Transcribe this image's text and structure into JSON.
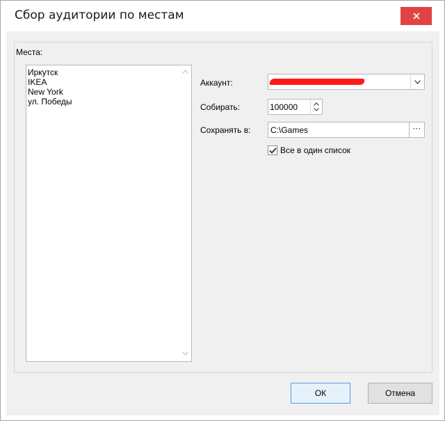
{
  "window": {
    "title": "Сбор аудитории по местам"
  },
  "places": {
    "label": "Места:",
    "items": [
      "Иркутск",
      "IKEA",
      "New York",
      "ул. Победы"
    ]
  },
  "form": {
    "account_label": "Аккаунт:",
    "account_value_redacted": true,
    "collect_label": "Собирать:",
    "collect_value": "100000",
    "save_label": "Сохранять в:",
    "save_value": "C:\\Games",
    "browse_label": "···",
    "single_list_label": "Все в один список",
    "single_list_checked": true
  },
  "buttons": {
    "ok": "ОК",
    "cancel": "Отмена"
  },
  "icons": {
    "close": "close-icon",
    "dropdown": "chevron-down-icon",
    "spin_up": "spin-up-icon",
    "spin_down": "spin-down-icon",
    "scroll_up": "scroll-up-icon",
    "scroll_down": "scroll-down-icon",
    "check": "check-icon"
  },
  "colors": {
    "close_button": "#e04343",
    "redaction": "#ff1a1a",
    "dialog_bg": "#f0f0f0"
  }
}
